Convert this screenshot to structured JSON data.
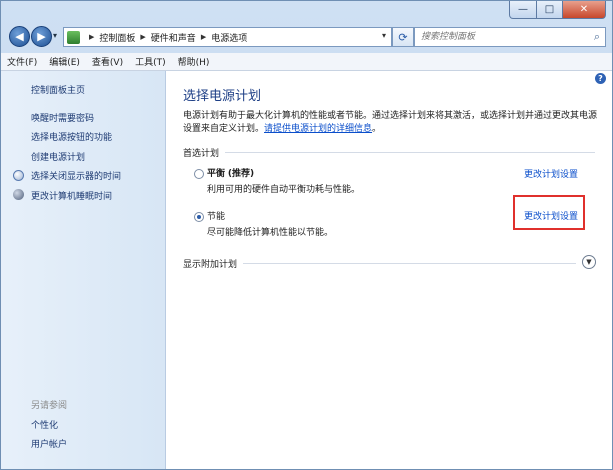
{
  "window": {
    "caption": {
      "minimize": "—",
      "maximize": "□",
      "close": "✕"
    }
  },
  "address": {
    "crumbs": [
      "控制面板",
      "硬件和声音",
      "电源选项"
    ]
  },
  "search": {
    "placeholder": "搜索控制面板"
  },
  "menu": {
    "items": [
      "文件(F)",
      "编辑(E)",
      "查看(V)",
      "工具(T)",
      "帮助(H)"
    ]
  },
  "sidebar": {
    "home": "控制面板主页",
    "links": [
      "唤醒时需要密码",
      "选择电源按钮的功能",
      "创建电源计划",
      "选择关闭显示器的时间",
      "更改计算机睡眠时间"
    ],
    "see_also": "另请参阅",
    "see_also_links": [
      "个性化",
      "用户帐户"
    ]
  },
  "main": {
    "title": "选择电源计划",
    "description": "电源计划有助于最大化计算机的性能或者节能。通过选择计划来将其激活，或选择计划并通过更改其电源设置来自定义计划。",
    "description_link": "请提供电源计划的详细信息",
    "description_end": "。",
    "preferred": "首选计划",
    "plans": [
      {
        "name": "平衡",
        "tag": "(推荐)",
        "desc": "利用可用的硬件自动平衡功耗与性能。",
        "link": "更改计划设置",
        "selected": false
      },
      {
        "name": "节能",
        "tag": "",
        "desc": "尽可能降低计算机性能以节能。",
        "link": "更改计划设置",
        "selected": true
      }
    ],
    "additional": "显示附加计划"
  },
  "colors": {
    "link": "#0a4ecb",
    "title": "#1e3f86",
    "highlight": "#e0302c"
  }
}
